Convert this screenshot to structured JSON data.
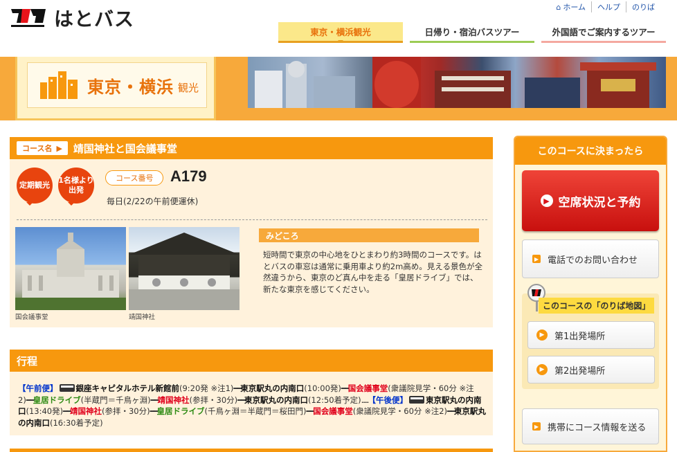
{
  "header": {
    "logo_text": "はとバス",
    "util_nav": [
      "ホーム",
      "ヘルプ",
      "のりば"
    ],
    "tabs": [
      "東京・横浜観光",
      "日帰り・宿泊バスツアー",
      "外国語でご案内するツアー"
    ]
  },
  "banner": {
    "title": "東京・横浜",
    "sub": "観光"
  },
  "course": {
    "tag_label": "コース名",
    "name": "靖国神社と国会議事堂",
    "badge1": "定期観光",
    "badge2": "1名様より出発",
    "number_label": "コース番号",
    "number": "A179",
    "schedule": "毎日(2/22の午前便運休)",
    "photo1_caption": "国会議事堂",
    "photo2_caption": "靖国神社",
    "highlight_title": "みどころ",
    "highlight_text": "短時間で東京の中心地をひとまわり約3時間のコースです。はとバスの車窓は通常に乗用車より約2m高め。見える景色が全然違うから、東京のど真ん中を走る「皇居ドライブ」では、新たな東京を感じてください。"
  },
  "itinerary": {
    "title": "行程",
    "am_tag": "【午前便】",
    "pm_tag": "【午後便】",
    "am": [
      {
        "t": "stop",
        "v": "銀座キャピタルホテル新館前"
      },
      {
        "t": "note",
        "v": "(9:20発 ※注1)"
      },
      {
        "t": "dash",
        "v": "━━"
      },
      {
        "t": "stop",
        "v": "東京駅丸の内南口"
      },
      {
        "t": "note",
        "v": "(10:00発)"
      },
      {
        "t": "dash",
        "v": "━━"
      },
      {
        "t": "red",
        "v": "国会議事堂"
      },
      {
        "t": "note",
        "v": "(衆議院見学・60分 ※注2)"
      },
      {
        "t": "dash",
        "v": "━━"
      },
      {
        "t": "green",
        "v": "皇居ドライブ"
      },
      {
        "t": "note",
        "v": "(半蔵門＝千鳥ヶ淵)"
      },
      {
        "t": "dash",
        "v": "━━"
      },
      {
        "t": "red",
        "v": "靖国神社"
      },
      {
        "t": "note",
        "v": "(参拝・30分)"
      },
      {
        "t": "dash",
        "v": "━━"
      },
      {
        "t": "stop",
        "v": "東京駅丸の内南口"
      },
      {
        "t": "note",
        "v": "(12:50着予定)"
      }
    ],
    "pm": [
      {
        "t": "stop",
        "v": "東京駅丸の内南口"
      },
      {
        "t": "note",
        "v": "(13:40発)"
      },
      {
        "t": "dash",
        "v": "━━"
      },
      {
        "t": "red",
        "v": "靖国神社"
      },
      {
        "t": "note",
        "v": "(参拝・30分)"
      },
      {
        "t": "dash",
        "v": "━━"
      },
      {
        "t": "green",
        "v": "皇居ドライブ"
      },
      {
        "t": "note",
        "v": "(千鳥ヶ淵＝半蔵門＝桜田門)"
      },
      {
        "t": "dash",
        "v": "━━"
      },
      {
        "t": "red",
        "v": "国会議事堂"
      },
      {
        "t": "note",
        "v": "(衆議院見学・60分 ※注2)"
      },
      {
        "t": "dash",
        "v": "━━"
      },
      {
        "t": "stop",
        "v": "東京駅丸の内南口"
      },
      {
        "t": "note",
        "v": "(16:30着予定)"
      }
    ],
    "sep": "......"
  },
  "sidebar": {
    "title": "このコースに決まったら",
    "reserve": "空席状況と予約",
    "phone": "電話でのお問い合わせ",
    "map_title_pre": "このコースの",
    "map_title_q": "「のりば地図」",
    "stop1": "第1出発場所",
    "stop2": "第2出発場所",
    "mobile": "携帯にコース情報を送る"
  },
  "colors": {
    "accent": "#f7980e",
    "red": "#e0001b",
    "green": "#2c8a12",
    "link": "#2255aa"
  }
}
